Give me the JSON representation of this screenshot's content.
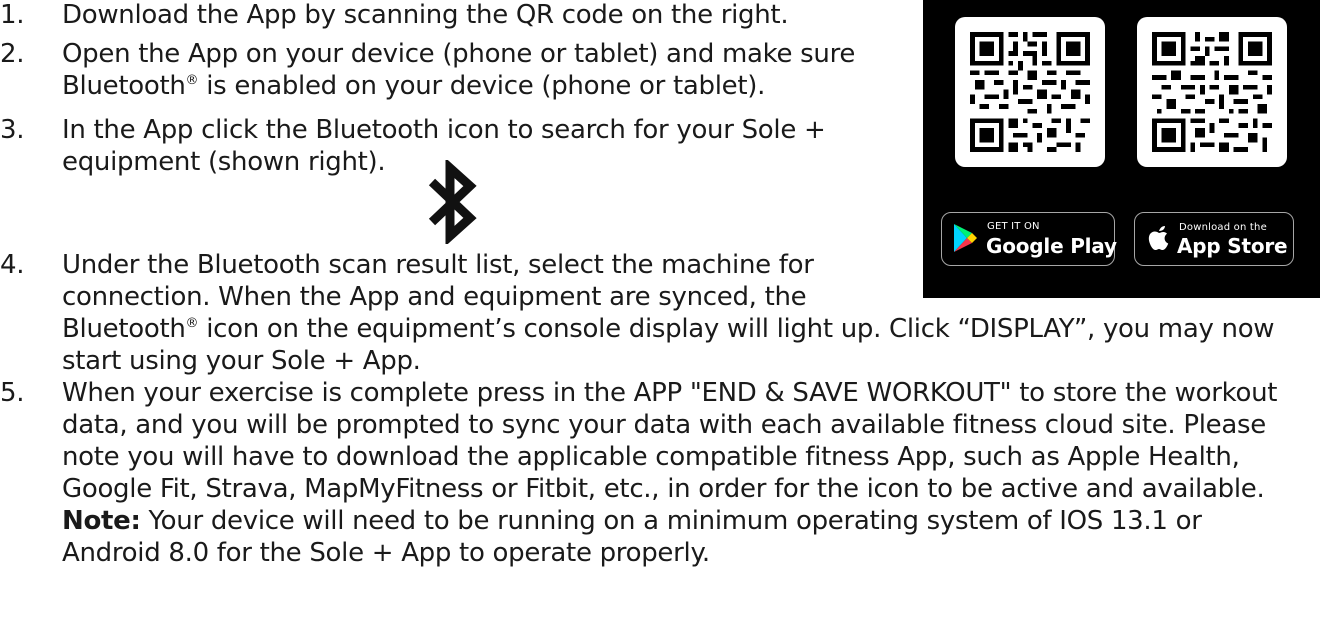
{
  "steps": [
    {
      "num": "1.",
      "text": "Download the App by scanning the QR code on the right."
    },
    {
      "num": "2.",
      "line1": "Open the App on your device (phone or tablet) and make sure",
      "line2_pre": "Bluetooth",
      "reg": "®",
      "line2_post": " is enabled on your device (phone or tablet)."
    },
    {
      "num": "3.",
      "line1": "In the App click the Bluetooth icon to search for your Sole +",
      "line2": "equipment (shown right)."
    },
    {
      "num": "4.",
      "line1": "Under the Bluetooth scan result list, select the machine for",
      "line2": "connection. When the App and equipment are synced, the",
      "line3_pre": "Bluetooth",
      "reg": "®",
      "line3_post": " icon on the equipment’s console display will light up. Click “DISPLAY”, you may now",
      "line4": "start using your Sole + App."
    },
    {
      "num": "5.",
      "line1": "When your exercise is complete press in the APP \"END & SAVE WORKOUT\" to store the workout",
      "line2": "data, and you will be prompted to sync your data with each available fitness cloud site.  Please",
      "line3": "note you will have to download the applicable compatible fitness App, such as Apple Health,",
      "line4": "Google Fit, Strava, MapMyFitness or Fitbit, etc., in order for the icon to be active and available.",
      "note_label": "Note:",
      "note_line1": " Your device will need to be running on a minimum operating system of IOS 13.1 or",
      "note_line2": "Android 8.0 for the Sole + App to operate properly."
    }
  ],
  "icons": {
    "bluetooth": "bluetooth-icon",
    "google_play": "google-play-icon",
    "apple": "apple-icon"
  },
  "badges": {
    "google_small": "GET IT ON",
    "google_big": "Google Play",
    "apple_small": "Download on the",
    "apple_big": "App Store"
  },
  "colors": {
    "promo_bg": "#000000",
    "text": "#1a1a1a",
    "badge_border": "#a6a6a6"
  }
}
